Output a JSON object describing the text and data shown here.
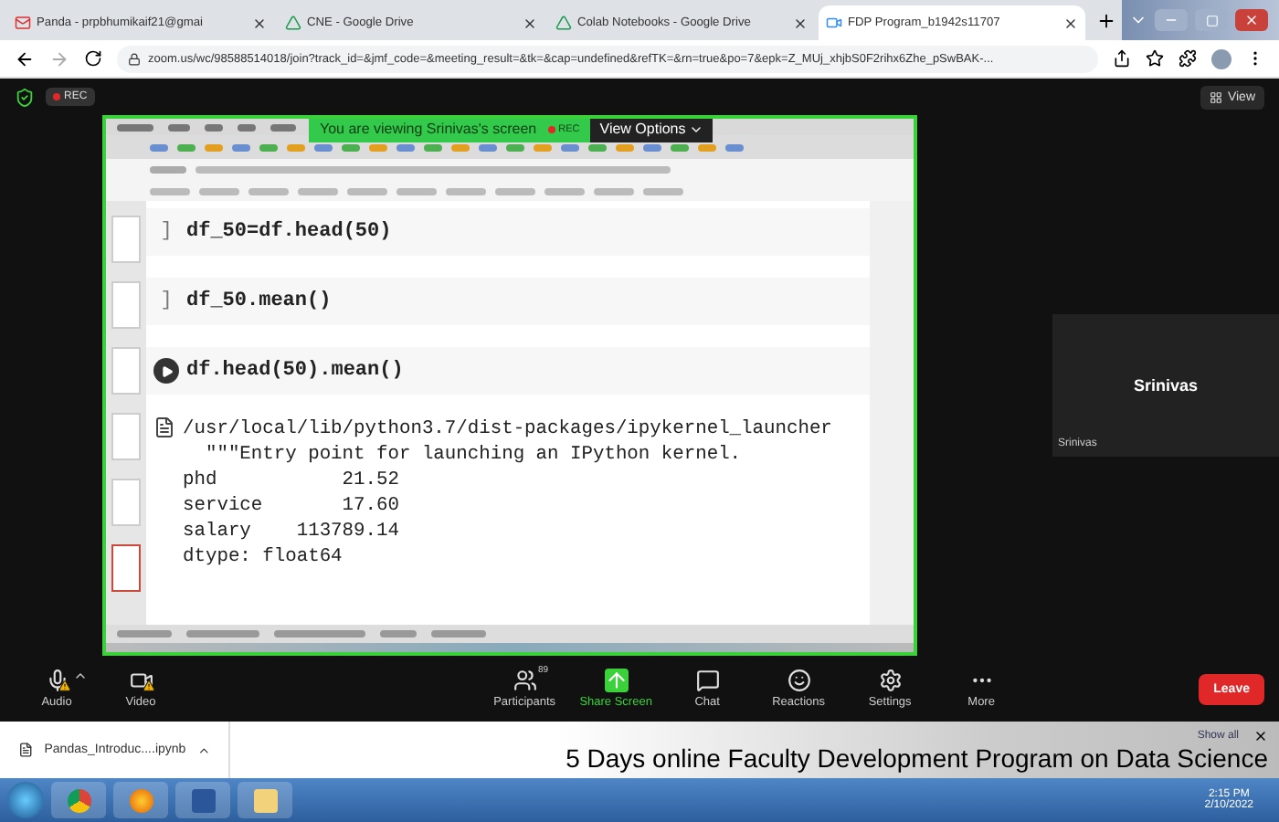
{
  "browser_tabs": [
    {
      "title": "Panda - prpbhumikaif21@gmai",
      "kind": "mail",
      "selected": false
    },
    {
      "title": "CNE - Google Drive",
      "kind": "drive",
      "selected": false
    },
    {
      "title": "Colab Notebooks - Google Drive",
      "kind": "drive",
      "selected": false
    },
    {
      "title": "FDP Program_b1942s11707",
      "kind": "zoom",
      "selected": true
    }
  ],
  "address_bar": {
    "url": "zoom.us/wc/98588514018/join?track_id=&jmf_code=&meeting_result=&tk=&cap=undefined&refTK=&rn=true&po=7&epk=Z_MUj_xhjbS0F2rihx6Zhe_pSwBAK-..."
  },
  "zoom_top": {
    "rec": "REC",
    "view": "View"
  },
  "share_banner": {
    "text": "You are viewing Srinivas's screen",
    "rec": "REC",
    "options": "View Options"
  },
  "notebook": {
    "cells": [
      {
        "kind": "idle",
        "marker": "]",
        "code": "df_50=df.head(50)"
      },
      {
        "kind": "idle",
        "marker": "]",
        "code": "df_50.mean()"
      },
      {
        "kind": "run",
        "code": "df.head(50).mean()"
      }
    ],
    "output": [
      "/usr/local/lib/python3.7/dist-packages/ipykernel_launcher",
      "  \"\"\"Entry point for launching an IPython kernel.",
      "phd           21.52",
      "service       17.60",
      "salary    113789.14",
      "dtype: float64"
    ]
  },
  "participant": {
    "name": "Srinivas",
    "label": "Srinivas"
  },
  "toolbar": {
    "left": [
      {
        "kind": "audio",
        "label": "Audio",
        "warning": true
      },
      {
        "kind": "video",
        "label": "Video",
        "warning": true
      }
    ],
    "center": [
      {
        "kind": "participants",
        "label": "Participants",
        "count": "89",
        "selected": false
      },
      {
        "kind": "share",
        "label": "Share Screen",
        "selected": true
      },
      {
        "kind": "chat",
        "label": "Chat",
        "selected": false
      },
      {
        "kind": "reactions",
        "label": "Reactions",
        "selected": false
      },
      {
        "kind": "settings",
        "label": "Settings",
        "selected": false
      },
      {
        "kind": "more",
        "label": "More",
        "selected": false
      }
    ],
    "leave": "Leave"
  },
  "download": {
    "file": "Pandas_Introduc....ipynb",
    "show_all": "Show all"
  },
  "caption": "5 Days online Faculty Development Program on Data Science",
  "taskbar": {
    "time": "2:15 PM",
    "date": "2/10/2022"
  }
}
